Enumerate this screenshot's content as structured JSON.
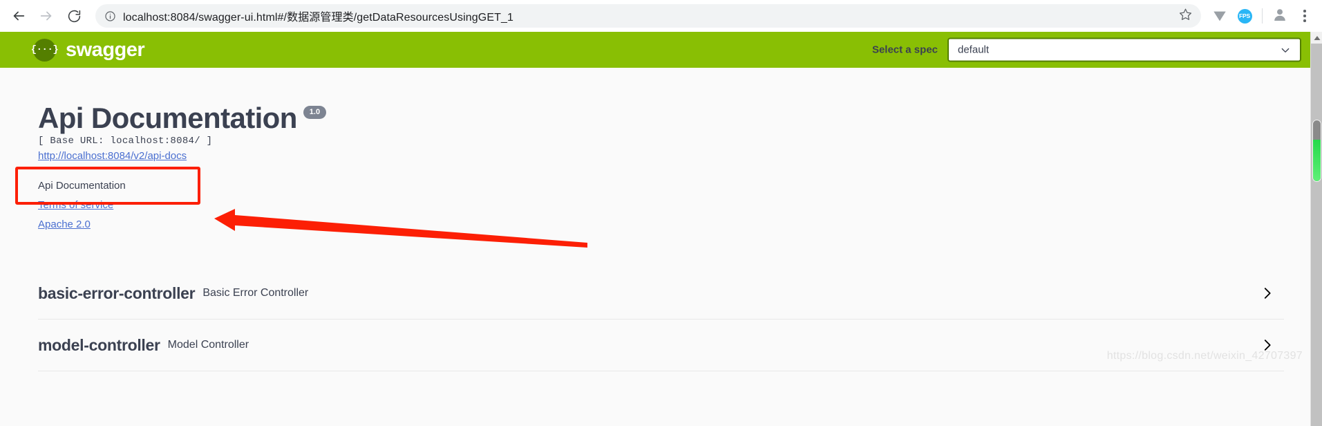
{
  "browser": {
    "back_label": "Back",
    "forward_label": "Forward",
    "reload_label": "Reload",
    "info_icon": "info-circle-icon",
    "url_scheme_host": "localhost:8084",
    "url_path": "/swagger-ui.html#/数据源管理类/getDataResourcesUsingGET_1",
    "url_full": "localhost:8084/swagger-ui.html#/数据源管理类/getDataResourcesUsingGET_1",
    "star_icon": "star-outline-icon",
    "extensions": [
      {
        "name": "vue-devtools-icon",
        "label": "V"
      },
      {
        "name": "fps-meter-icon",
        "label": "FPS"
      }
    ],
    "avatar_icon": "user-avatar-icon",
    "menu_icon": "three-dot-menu-icon"
  },
  "topbar": {
    "logo_glyph": "{···}",
    "logo_text": "swagger",
    "spec_label": "Select a spec",
    "spec_selected": "default",
    "spec_chevron": "chevron-down-icon"
  },
  "info": {
    "title": "Api Documentation",
    "version": "1.0",
    "base_url": "[ Base URL: localhost:8084/ ]",
    "api_docs_link": "http://localhost:8084/v2/api-docs",
    "description": "Api Documentation",
    "terms_link": "Terms of service",
    "license_link": "Apache 2.0"
  },
  "tags": [
    {
      "name": "basic-error-controller",
      "description": "Basic Error Controller",
      "chevron": "chevron-right-icon"
    },
    {
      "name": "model-controller",
      "description": "Model Controller",
      "chevron": "chevron-right-icon"
    }
  ],
  "annotations": {
    "highlight_color": "#fc1f05",
    "box_target": "api-docs-url",
    "arrow_direction": "left"
  },
  "watermark": "https://blog.csdn.net/weixin_42707397",
  "colors": {
    "swagger_green": "#89bf04",
    "logo_dark_green": "#547f00",
    "text_dark": "#3b4151",
    "link_blue": "#4a6fd0",
    "badge_gray": "#7d8492",
    "annotation_red": "#fc1f05"
  }
}
